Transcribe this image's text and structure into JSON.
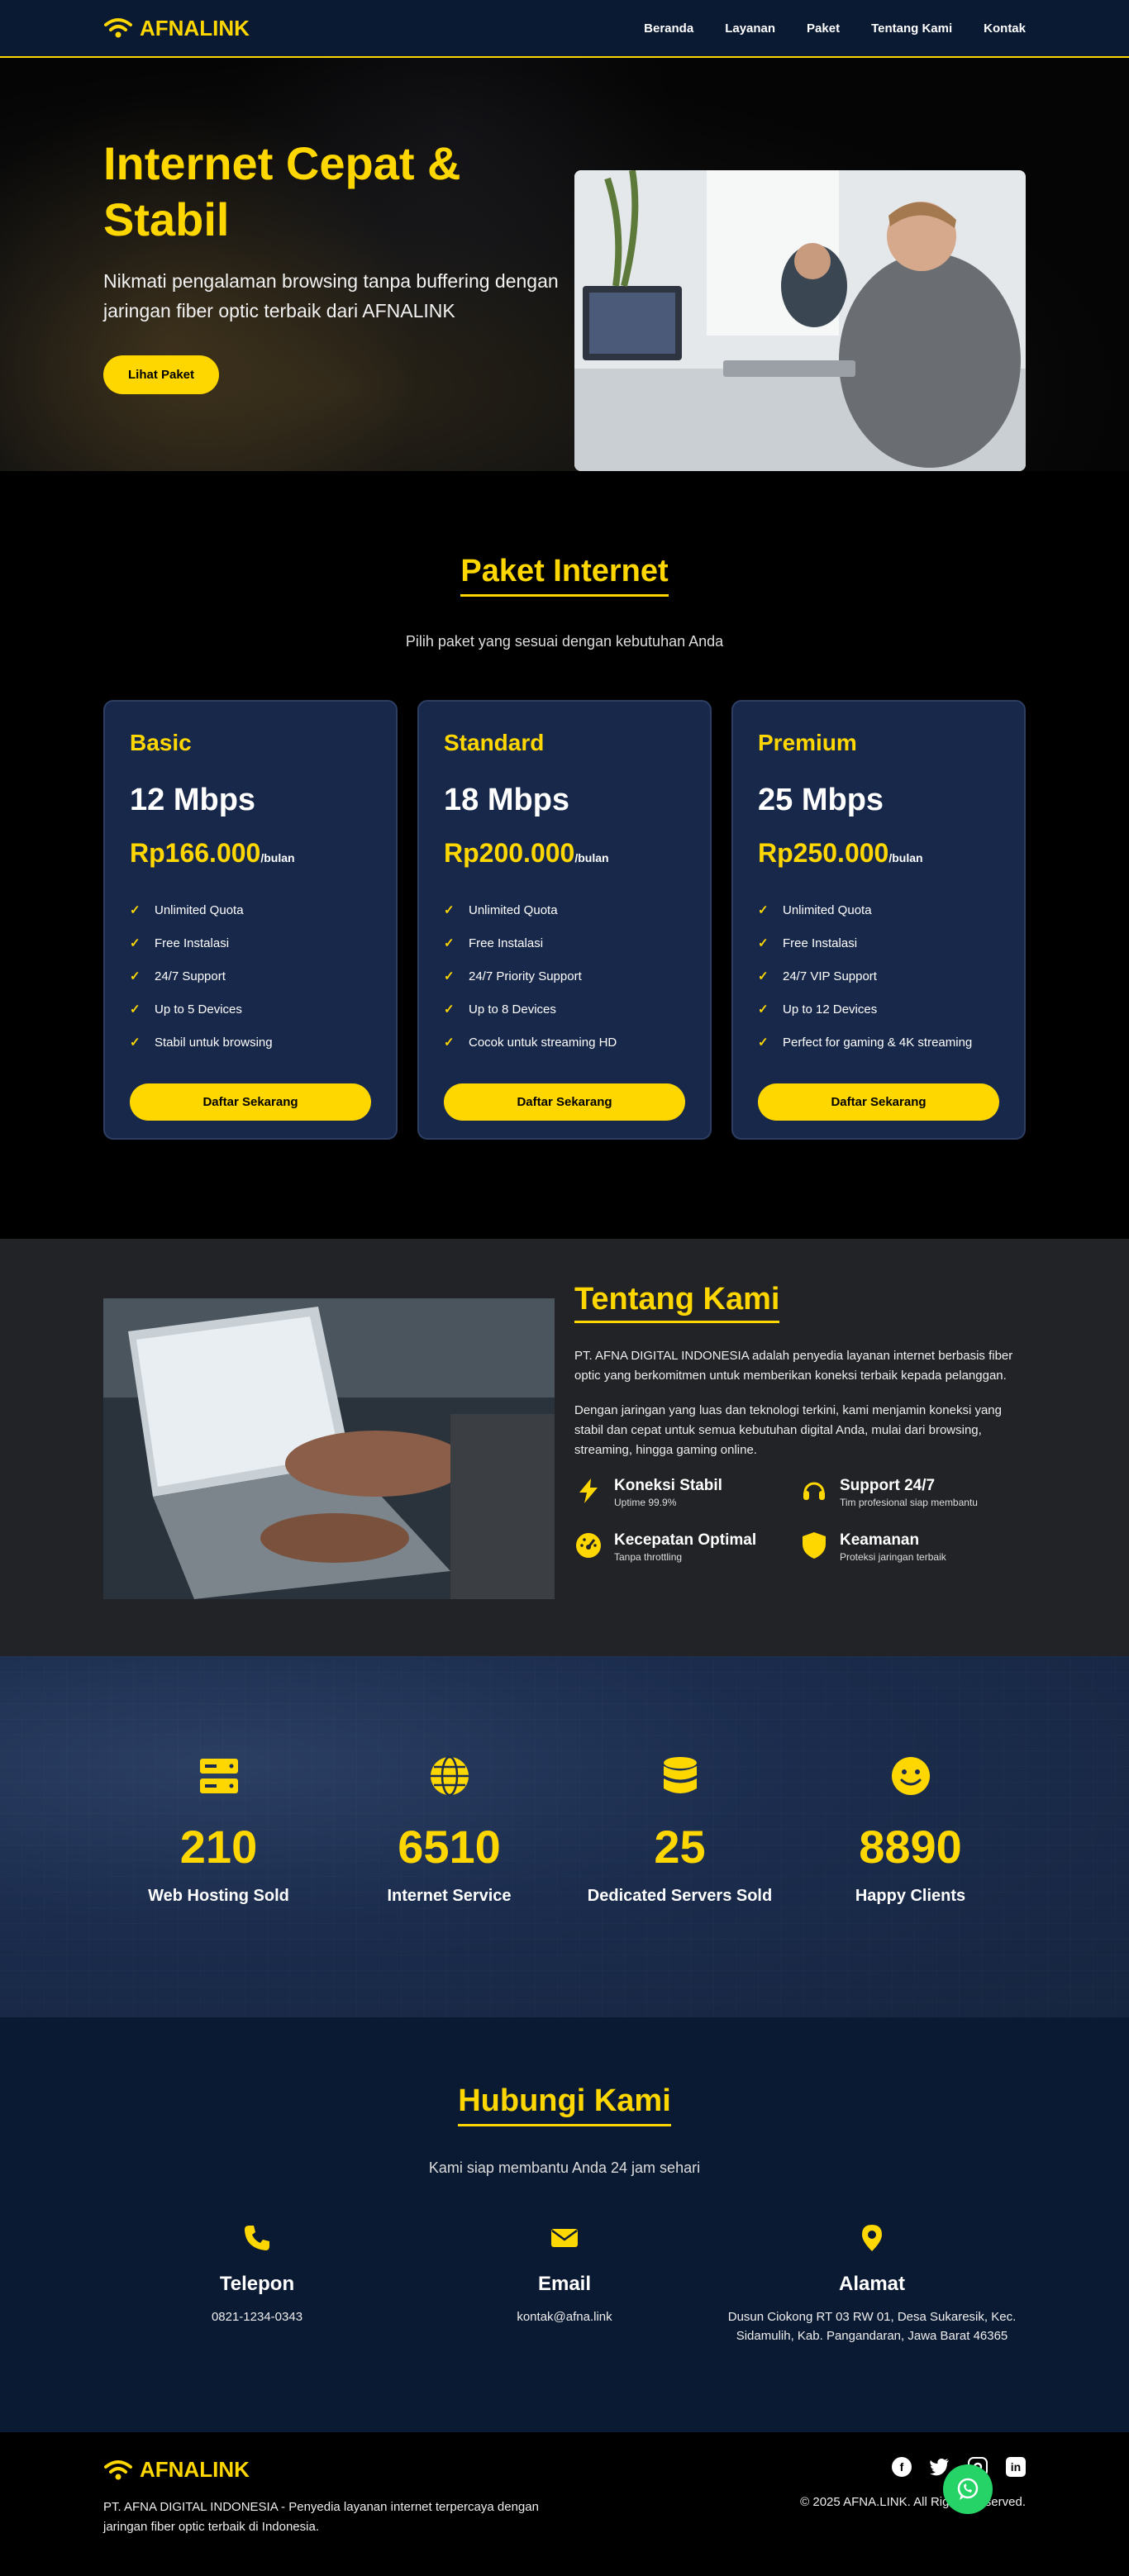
{
  "brand": {
    "name": "AFNALINK",
    "accent": "#ffd700",
    "navy": "#0b1a33"
  },
  "nav": {
    "items": [
      "Beranda",
      "Layanan",
      "Paket",
      "Tentang Kami",
      "Kontak"
    ]
  },
  "hero": {
    "title": "Internet Cepat & Stabil",
    "subtitle": "Nikmati pengalaman browsing tanpa buffering dengan jaringan fiber optic terbaik dari AFNALINK",
    "cta": "Lihat Paket"
  },
  "packages": {
    "title": "Paket Internet",
    "subtitle": "Pilih paket yang sesuai dengan kebutuhan Anda",
    "cards": [
      {
        "name": "Basic",
        "speed": "12 Mbps",
        "price": "Rp166.000",
        "period": "/bulan",
        "features": [
          "Unlimited Quota",
          "Free Instalasi",
          "24/7 Support",
          "Up to 5 Devices",
          "Stabil untuk browsing"
        ],
        "button": "Daftar Sekarang"
      },
      {
        "name": "Standard",
        "speed": "18 Mbps",
        "price": "Rp200.000",
        "period": "/bulan",
        "features": [
          "Unlimited Quota",
          "Free Instalasi",
          "24/7 Priority Support",
          "Up to 8 Devices",
          "Cocok untuk streaming HD"
        ],
        "button": "Daftar Sekarang"
      },
      {
        "name": "Premium",
        "speed": "25 Mbps",
        "price": "Rp250.000",
        "period": "/bulan",
        "features": [
          "Unlimited Quota",
          "Free Instalasi",
          "24/7 VIP Support",
          "Up to 12 Devices",
          "Perfect for gaming & 4K streaming"
        ],
        "button": "Daftar Sekarang"
      }
    ]
  },
  "about": {
    "title": "Tentang Kami",
    "p1": "PT. AFNA DIGITAL INDONESIA adalah penyedia layanan internet berbasis fiber optic yang berkomitmen untuk memberikan koneksi terbaik kepada pelanggan.",
    "p2": "Dengan jaringan yang luas dan teknologi terkini, kami menjamin koneksi yang stabil dan cepat untuk semua kebutuhan digital Anda, mulai dari browsing, streaming, hingga gaming online.",
    "features": [
      {
        "icon": "bolt-icon",
        "title": "Koneksi Stabil",
        "sub": "Uptime 99.9%"
      },
      {
        "icon": "headset-icon",
        "title": "Support 24/7",
        "sub": "Tim profesional siap membantu"
      },
      {
        "icon": "speedometer-icon",
        "title": "Kecepatan Optimal",
        "sub": "Tanpa throttling"
      },
      {
        "icon": "shield-icon",
        "title": "Keamanan",
        "sub": "Proteksi jaringan terbaik"
      }
    ]
  },
  "stats": [
    {
      "icon": "server-icon",
      "value": "210",
      "label": "Web Hosting Sold"
    },
    {
      "icon": "globe-icon",
      "value": "6510",
      "label": "Internet Service"
    },
    {
      "icon": "database-icon",
      "value": "25",
      "label": "Dedicated Servers Sold"
    },
    {
      "icon": "smile-icon",
      "value": "8890",
      "label": "Happy Clients"
    }
  ],
  "contact": {
    "title": "Hubungi Kami",
    "subtitle": "Kami siap membantu Anda 24 jam sehari",
    "items": [
      {
        "icon": "phone-icon",
        "title": "Telepon",
        "value": "0821-1234-0343"
      },
      {
        "icon": "envelope-icon",
        "title": "Email",
        "value": "kontak@afna.link"
      },
      {
        "icon": "map-pin-icon",
        "title": "Alamat",
        "value": "Dusun Ciokong RT 03 RW 01, Desa Sukaresik, Kec. Sidamulih, Kab. Pangandaran, Jawa Barat 46365"
      }
    ]
  },
  "footer": {
    "brand": "AFNALINK",
    "description": "PT. AFNA DIGITAL INDONESIA - Penyedia layanan internet terpercaya dengan jaringan fiber optic terbaik di Indonesia.",
    "copyright": "© 2025 AFNA.LINK. All Rights Reserved.",
    "socials": [
      "facebook-icon",
      "twitter-icon",
      "instagram-icon",
      "linkedin-icon"
    ]
  }
}
